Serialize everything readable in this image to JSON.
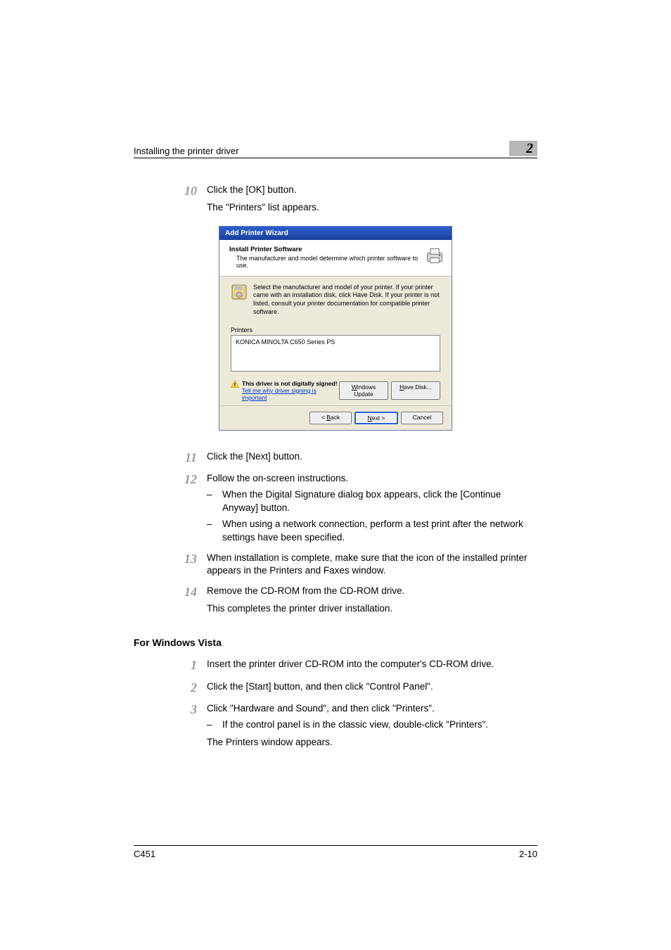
{
  "header": {
    "title": "Installing the printer driver",
    "chapter": "2"
  },
  "steps_a": [
    {
      "num": "10",
      "text": "Click the [OK] button.",
      "sub": "The \"Printers\" list appears."
    }
  ],
  "wizard": {
    "titlebar": "Add Printer Wizard",
    "head_title": "Install Printer Software",
    "head_sub": "The manufacturer and model determine which printer software to use.",
    "info": "Select the manufacturer and model of your printer. If your printer came with an installation disk, click Have Disk. If your printer is not listed, consult your printer documentation for compatible printer software.",
    "printers_label": "Printers",
    "printer_item": "KONICA MINOLTA C650 Series PS",
    "warn_title": "This driver is not digitally signed!",
    "warn_link": "Tell me why driver signing is important",
    "btn_windows_update": "Windows Update",
    "btn_have_disk": "Have Disk...",
    "btn_back": "< Back",
    "btn_next": "Next >",
    "btn_cancel": "Cancel"
  },
  "steps_b": [
    {
      "num": "11",
      "text": "Click the [Next] button."
    },
    {
      "num": "12",
      "text": "Follow the on-screen instructions.",
      "bullets": [
        "When the Digital Signature dialog box appears, click the [Continue Anyway] button.",
        "When using a network connection, perform a test print after the network settings have been specified."
      ]
    },
    {
      "num": "13",
      "text": "When installation is complete, make sure that the icon of the installed printer appears in the Printers and Faxes window."
    },
    {
      "num": "14",
      "text": "Remove the CD-ROM from the CD-ROM drive.",
      "sub": "This completes the printer driver installation."
    }
  ],
  "section_heading": "For Windows Vista",
  "steps_c": [
    {
      "num": "1",
      "text": "Insert the printer driver CD-ROM into the computer's CD-ROM drive."
    },
    {
      "num": "2",
      "text": "Click the [Start] button, and then click \"Control Panel\"."
    },
    {
      "num": "3",
      "text": "Click \"Hardware and Sound\", and then click \"Printers\".",
      "bullets": [
        "If the control panel is in the classic view, double-click \"Printers\"."
      ],
      "sub": "The Printers window appears."
    }
  ],
  "footer": {
    "left": "C451",
    "right": "2-10"
  }
}
